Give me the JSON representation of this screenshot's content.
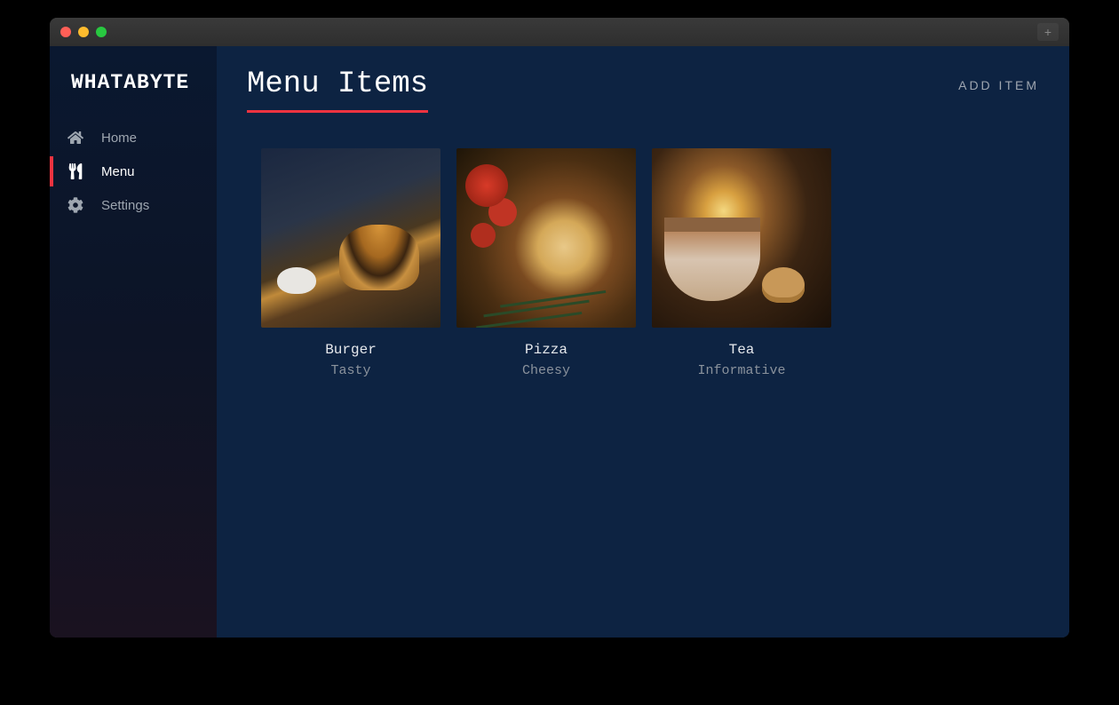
{
  "app": {
    "brand": "WHATABYTE"
  },
  "sidebar": {
    "items": [
      {
        "label": "Home",
        "icon": "home-icon",
        "active": false
      },
      {
        "label": "Menu",
        "icon": "utensils-icon",
        "active": true
      },
      {
        "label": "Settings",
        "icon": "gear-icon",
        "active": false
      }
    ]
  },
  "page": {
    "title": "Menu Items",
    "add_action": "ADD ITEM"
  },
  "menu": {
    "items": [
      {
        "name": "Burger",
        "desc": "Tasty"
      },
      {
        "name": "Pizza",
        "desc": "Cheesy"
      },
      {
        "name": "Tea",
        "desc": "Informative"
      }
    ]
  },
  "colors": {
    "accent": "#ef3340",
    "bg_sidebar": "#0a1830",
    "bg_main": "#0d2342",
    "text_primary": "#ffffff",
    "text_muted": "#9ea6b0"
  }
}
